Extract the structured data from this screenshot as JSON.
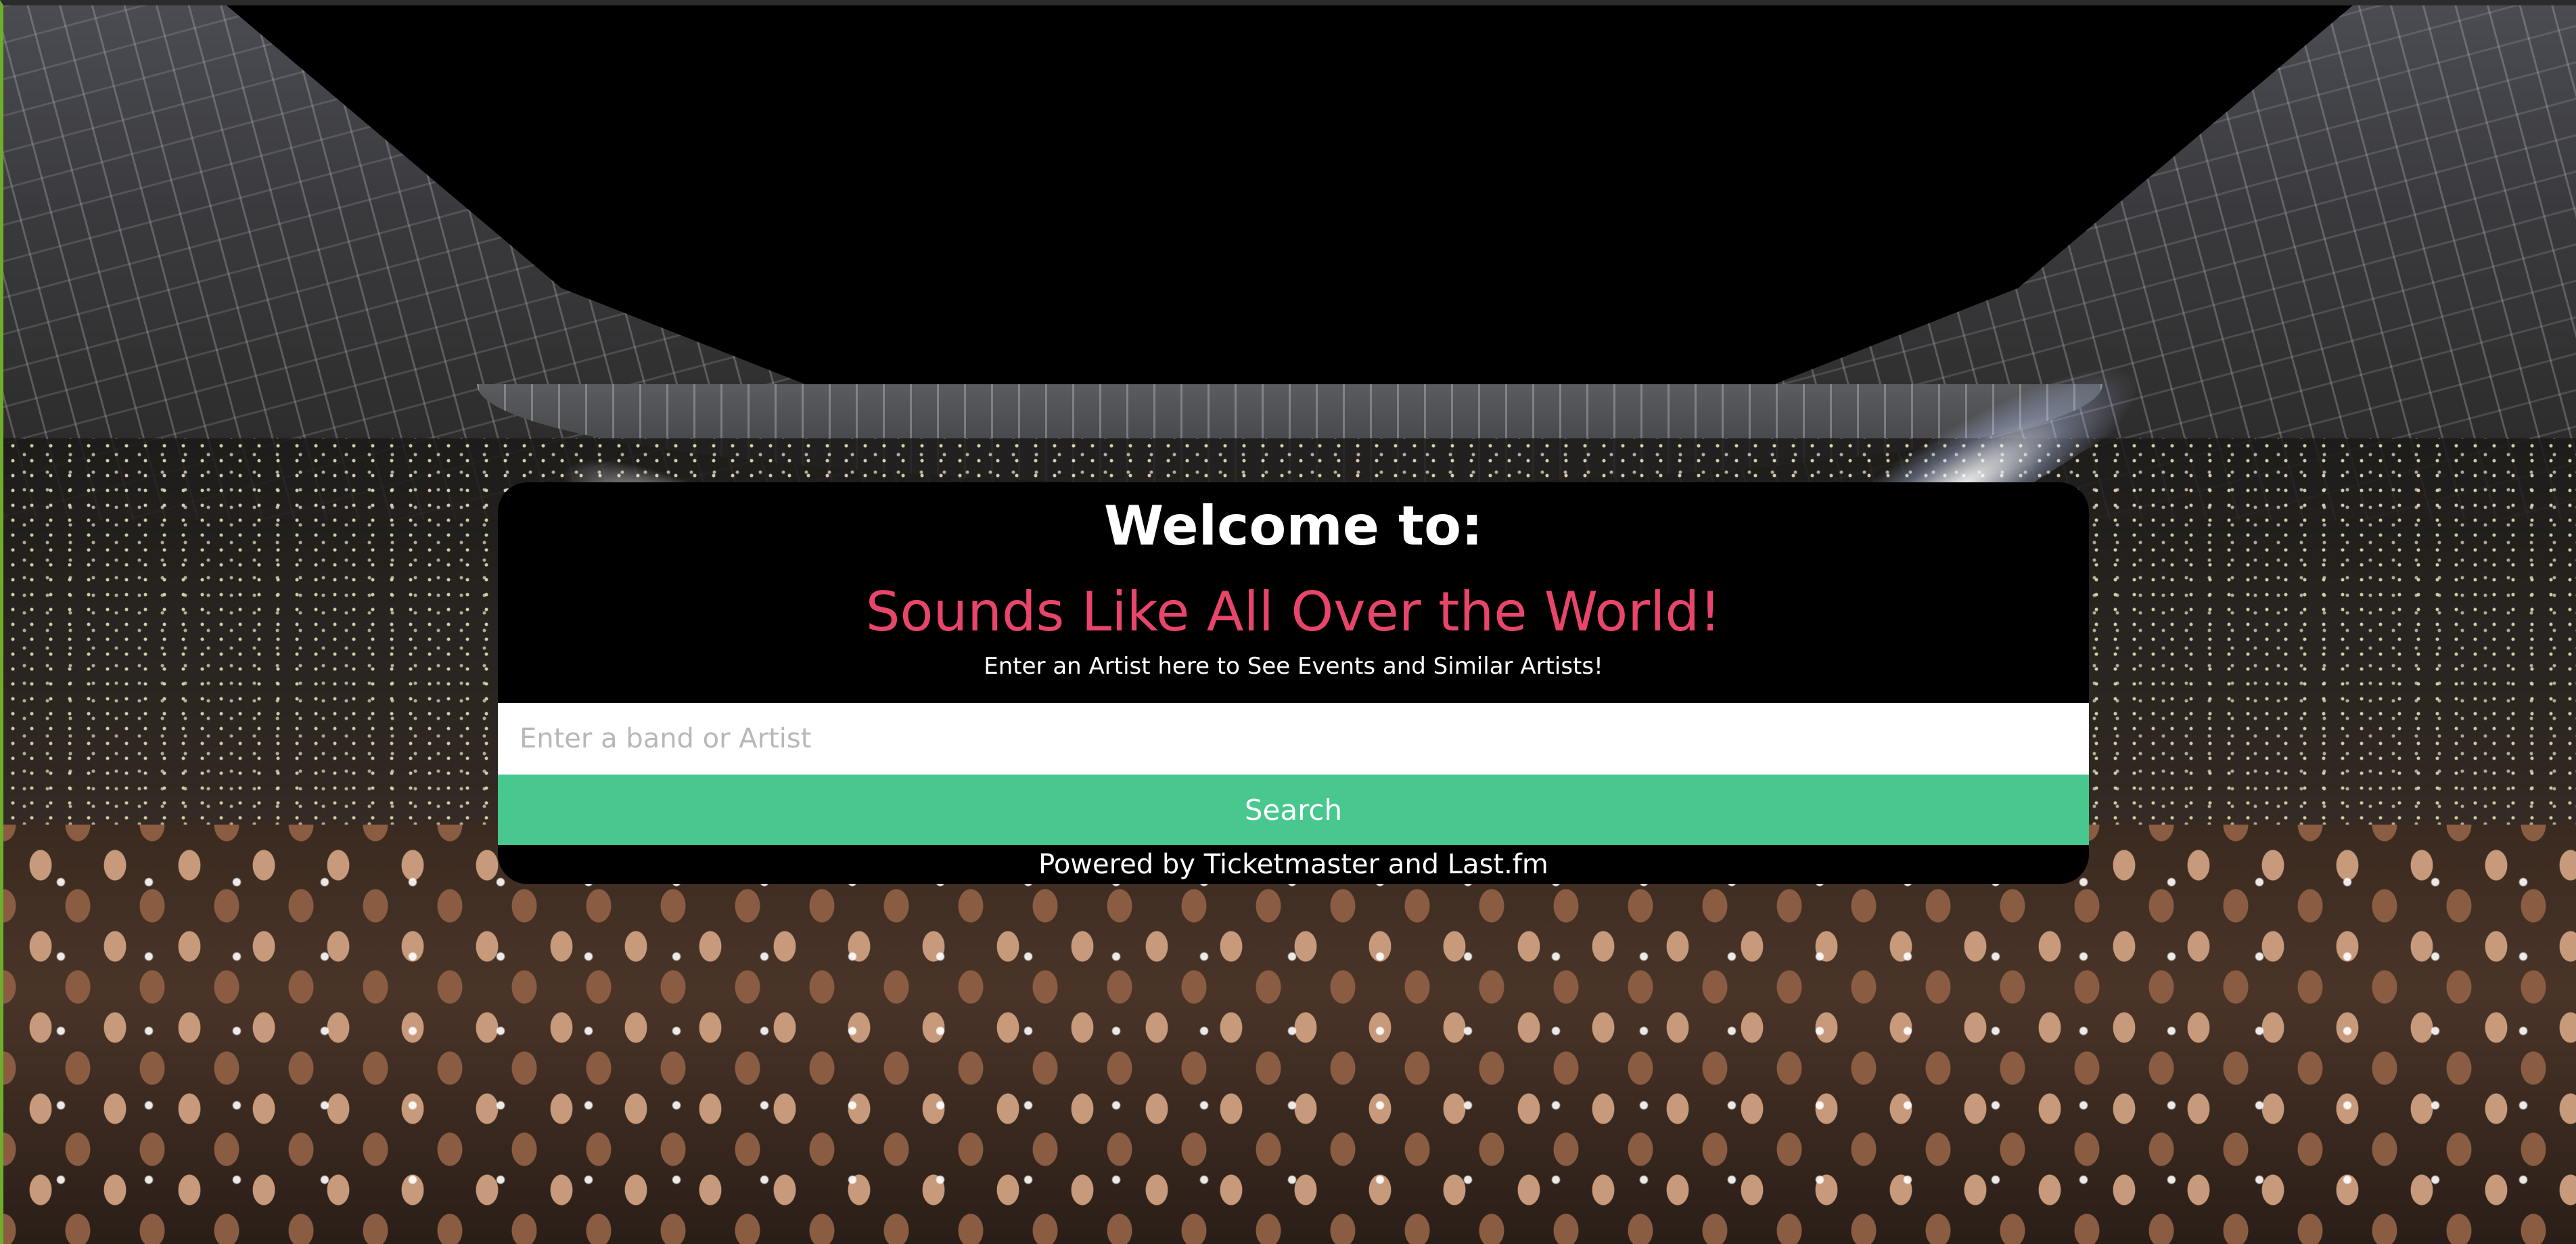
{
  "hero": {
    "welcome_text": "Welcome to:",
    "app_title": "Sounds Like All Over the World!",
    "subtitle": "Enter an Artist here to See Events and Similar Artists!"
  },
  "search": {
    "placeholder": "Enter a band or Artist",
    "value": "",
    "button_label": "Search"
  },
  "footer": {
    "powered_by": "Powered by Ticketmaster and Last.fm"
  },
  "colors": {
    "card_background": "#000000",
    "title_accent": "#e8456b",
    "search_button": "#48c78e",
    "text": "#ffffff"
  },
  "background": {
    "image_description_icon": "concert-crowd-stadium-image"
  }
}
